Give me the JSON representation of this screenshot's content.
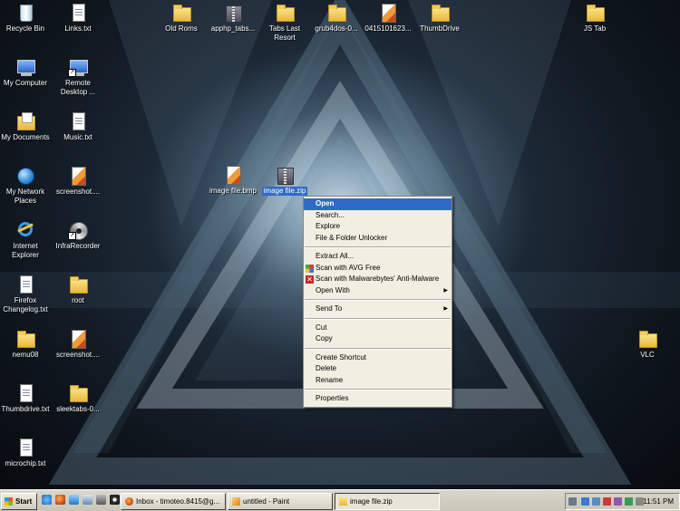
{
  "desktop": {
    "icons": [
      {
        "label": "Recycle Bin",
        "icon": "recycle-bin-icon"
      },
      {
        "label": "Links.txt",
        "icon": "text-file-icon"
      },
      {
        "label": "Old Roms",
        "icon": "folder-icon"
      },
      {
        "label": "apphp_tabs...",
        "icon": "zip-file-icon"
      },
      {
        "label": "Tabs Last Resort",
        "icon": "folder-icon"
      },
      {
        "label": "grub4dos-0...",
        "icon": "folder-icon"
      },
      {
        "label": "0415101623...",
        "icon": "image-file-icon"
      },
      {
        "label": "ThumbDrive",
        "icon": "folder-icon"
      },
      {
        "label": "JS Tab",
        "icon": "folder-icon"
      },
      {
        "label": "My Computer",
        "icon": "computer-icon"
      },
      {
        "label": "Remote Desktop ...",
        "icon": "remote-desktop-icon"
      },
      {
        "label": "My Documents",
        "icon": "documents-folder-icon"
      },
      {
        "label": "Music.txt",
        "icon": "text-file-icon"
      },
      {
        "label": "My Network Places",
        "icon": "network-icon"
      },
      {
        "label": "screenshot....",
        "icon": "image-file-icon"
      },
      {
        "label": "Internet Explorer",
        "icon": "internet-explorer-icon"
      },
      {
        "label": "InfraRecorder",
        "icon": "disc-icon"
      },
      {
        "label": "Firefox Changelog.txt",
        "icon": "text-file-icon"
      },
      {
        "label": "root",
        "icon": "folder-icon"
      },
      {
        "label": "nemu08",
        "icon": "folder-icon"
      },
      {
        "label": "screenshot....",
        "icon": "image-file-icon"
      },
      {
        "label": "Thumbdrive.txt",
        "icon": "text-file-icon"
      },
      {
        "label": "sleektabs-0...",
        "icon": "folder-icon"
      },
      {
        "label": "microchip.txt",
        "icon": "text-file-icon"
      },
      {
        "label": "VLC",
        "icon": "folder-icon"
      },
      {
        "label": "image file.bmp",
        "icon": "image-file-icon"
      },
      {
        "label": "image file.zip",
        "icon": "zip-file-icon"
      }
    ]
  },
  "context_menu": {
    "items": [
      {
        "label": "Open"
      },
      {
        "label": "Search..."
      },
      {
        "label": "Explore"
      },
      {
        "label": "File & Folder Unlocker"
      },
      {
        "label": "Extract All..."
      },
      {
        "label": "Scan with AVG Free"
      },
      {
        "label": "Scan with Malwarebytes' Anti-Malware"
      },
      {
        "label": "Open With"
      },
      {
        "label": "Send To"
      },
      {
        "label": "Cut"
      },
      {
        "label": "Copy"
      },
      {
        "label": "Create Shortcut"
      },
      {
        "label": "Delete"
      },
      {
        "label": "Rename"
      },
      {
        "label": "Properties"
      }
    ]
  },
  "taskbar": {
    "start_label": "Start",
    "quick_launch": [
      "ie-icon",
      "firefox-icon",
      "media-icon",
      "desktop-icon",
      "camera-icon",
      "player-icon"
    ],
    "tasks": [
      {
        "label": "Inbox - timoteo.8415@g...",
        "icon": "firefox-icon"
      },
      {
        "label": "untitled - Paint",
        "icon": "paint-icon"
      },
      {
        "label": "image file.zip",
        "icon": "folder-icon"
      }
    ],
    "clock": "11:51 PM"
  },
  "colors": {
    "selection": "#316ac5",
    "menu_bg": "#f1efe2",
    "taskbar_bg": "#d4d0c8"
  }
}
